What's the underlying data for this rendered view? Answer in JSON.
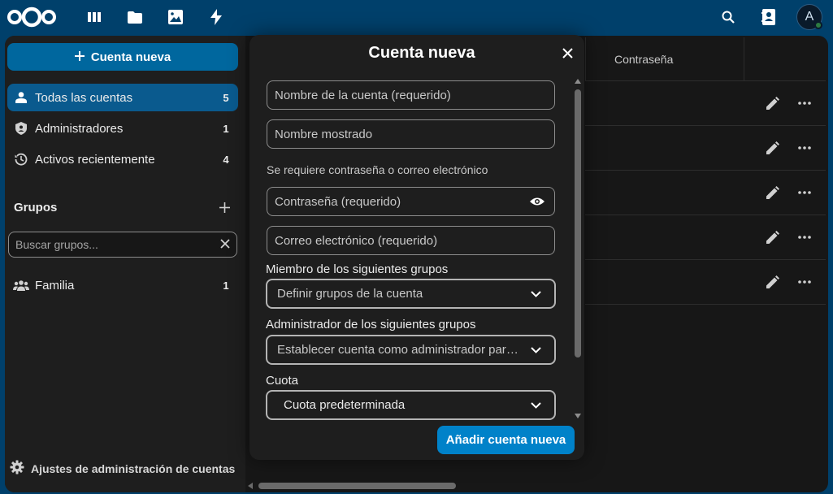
{
  "topbar": {
    "apps": [
      "dashboard-icon",
      "files-icon",
      "photos-icon",
      "activity-icon"
    ],
    "avatar_letter": "A"
  },
  "sidebar": {
    "new_account_label": "Cuenta nueva",
    "items": [
      {
        "label": "Todas las cuentas",
        "count": "5",
        "icon": "user-icon",
        "active": true
      },
      {
        "label": "Administradores",
        "count": "1",
        "icon": "shield-icon",
        "active": false
      },
      {
        "label": "Activos recientemente",
        "count": "4",
        "icon": "history-icon",
        "active": false
      }
    ],
    "groups_title": "Grupos",
    "search_placeholder": "Buscar grupos...",
    "groups": [
      {
        "label": "Familia",
        "count": "1",
        "icon": "group-icon"
      }
    ],
    "settings_label": "Ajustes de administración de cuentas"
  },
  "table": {
    "password_header": "Contraseña"
  },
  "modal": {
    "title": "Cuenta nueva",
    "account_name_placeholder": "Nombre de la cuenta (requerido)",
    "display_name_placeholder": "Nombre mostrado",
    "password_hint": "Se requiere contraseña o correo electrónico",
    "password_placeholder": "Contraseña (requerido)",
    "email_placeholder": "Correo electrónico (requerido)",
    "groups_label": "Miembro de los siguientes grupos",
    "groups_placeholder": "Definir grupos de la cuenta",
    "admin_label": "Administrador de los siguientes grupos",
    "admin_placeholder": "Establecer cuenta como administrador para...",
    "quota_label": "Cuota",
    "quota_value": "Cuota predeterminada",
    "submit_label": "Añadir cuenta nueva"
  },
  "colors": {
    "header": "#00406b",
    "primary": "#0082c9",
    "active": "#0a5a8e",
    "background": "#171717"
  }
}
